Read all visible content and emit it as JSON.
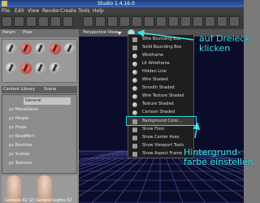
{
  "titlebar": {
    "title": "Studio 1.4.16.0"
  },
  "menubar": {
    "items": [
      "File",
      "Edit",
      "View",
      "Render",
      "Create",
      "Tools",
      "Help"
    ]
  },
  "left_panel": {
    "param_tabs": [
      "Param",
      "Pose"
    ],
    "library_tabs": [
      "Content Library",
      "Scene"
    ],
    "categories": [
      {
        "prefix": "pz",
        "label": "General"
      },
      {
        "prefix": "pz",
        "label": "MetaGlaniv"
      },
      {
        "prefix": "pz",
        "label": "People"
      },
      {
        "prefix": "pz",
        "label": "Props"
      },
      {
        "prefix": "pz",
        "label": "ReadMe's"
      },
      {
        "prefix": "pz",
        "label": "Runtime"
      },
      {
        "prefix": "pz",
        "label": "Scenes"
      },
      {
        "prefix": "pz",
        "label": "Textures"
      }
    ],
    "figures": [
      "Genesis 02 (2)",
      "General Lights 02"
    ]
  },
  "viewport": {
    "label": "Perspective View"
  },
  "menu": {
    "items": [
      "Wire Bounding Box",
      "Solid Bounding Box",
      "Wireframe",
      "Lit Wireframe",
      "Hidden Line",
      "Wire Shaded",
      "Smooth Shaded",
      "Wire Texture Shaded",
      "Texture Shaded",
      "Cartoon Shaded",
      "Background Color...",
      "Show Floor",
      "Show Center Axes",
      "Show Viewport Tools",
      "Show Aspect Frame"
    ],
    "highlighted_index": 10
  },
  "callouts": {
    "top_line1": "auf Dreieck",
    "top_line2": "klicken",
    "bottom_line1": "Hintergrund-",
    "bottom_line2": "farbe einstellen"
  },
  "colors": {
    "accent": "#38e6e6",
    "viewport_bg": "#0b0c2a",
    "grid": "#6a6fd6"
  }
}
